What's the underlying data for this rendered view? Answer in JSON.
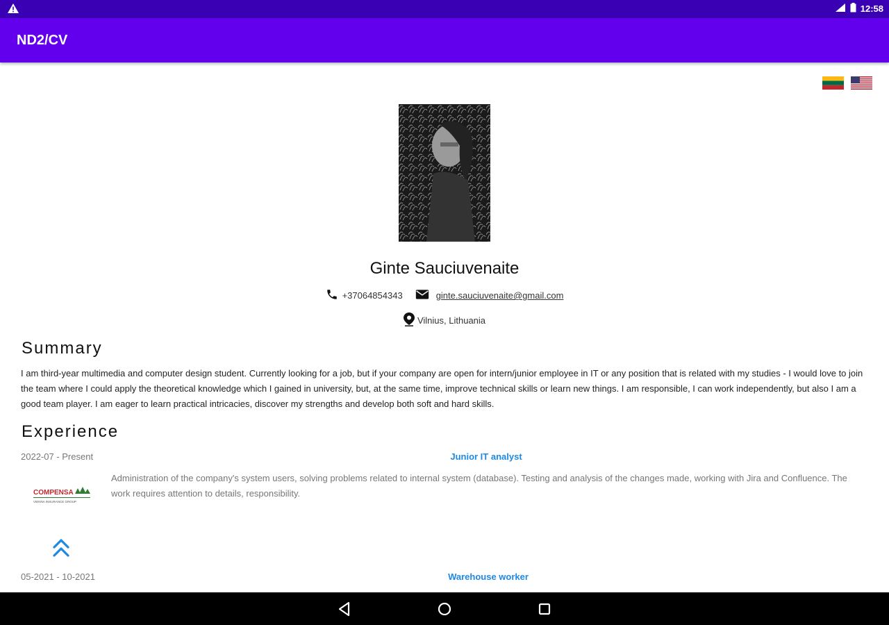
{
  "status_bar": {
    "time": "12:58",
    "icons": [
      "warning-icon",
      "signal-icon",
      "battery-icon"
    ]
  },
  "app_bar": {
    "title": "ND2/CV",
    "color": "#6200ee"
  },
  "language_flags": [
    {
      "name": "lithuanian-flag-icon",
      "colors": [
        "#fdb913",
        "#006a44",
        "#c1272d"
      ]
    },
    {
      "name": "us-flag-icon"
    }
  ],
  "profile": {
    "name": "Ginte Sauciuvenaite",
    "phone": "+37064854343",
    "email": "ginte.sauciuvenaite@gmail.com",
    "location": "Vilnius, Lithuania"
  },
  "summary": {
    "heading": "Summary",
    "text": "I am third-year multimedia and computer design student. Currently looking for a job, but if your company are open for intern/junior employee in IT or any position that is related with my studies - I would love to join the team where I could apply the theoretical knowledge which I gained in university, but, at the same time, improve technical skills or learn new things. I am responsible, I can work independently, but also I am a good team player. I am eager to learn practical intricacies, discover my strengths and develop both soft and hard skills."
  },
  "experience": {
    "heading": "Experience",
    "jobs": [
      {
        "dates": "2022-07 - Present",
        "title": "Junior IT analyst",
        "description": "Administration of the company's system users, solving problems related to internal system (database). Testing and analysis of the changes made, working with Jira and Confluence. The work requires attention to details, responsibility.",
        "logo_text": "COMPENSA",
        "logo_subtext": "VIENNA INSURANCE GROUP"
      },
      {
        "dates": "05-2021 - 10-2021",
        "title": "Warehouse worker"
      }
    ]
  },
  "accent_color": "#1e88e5"
}
